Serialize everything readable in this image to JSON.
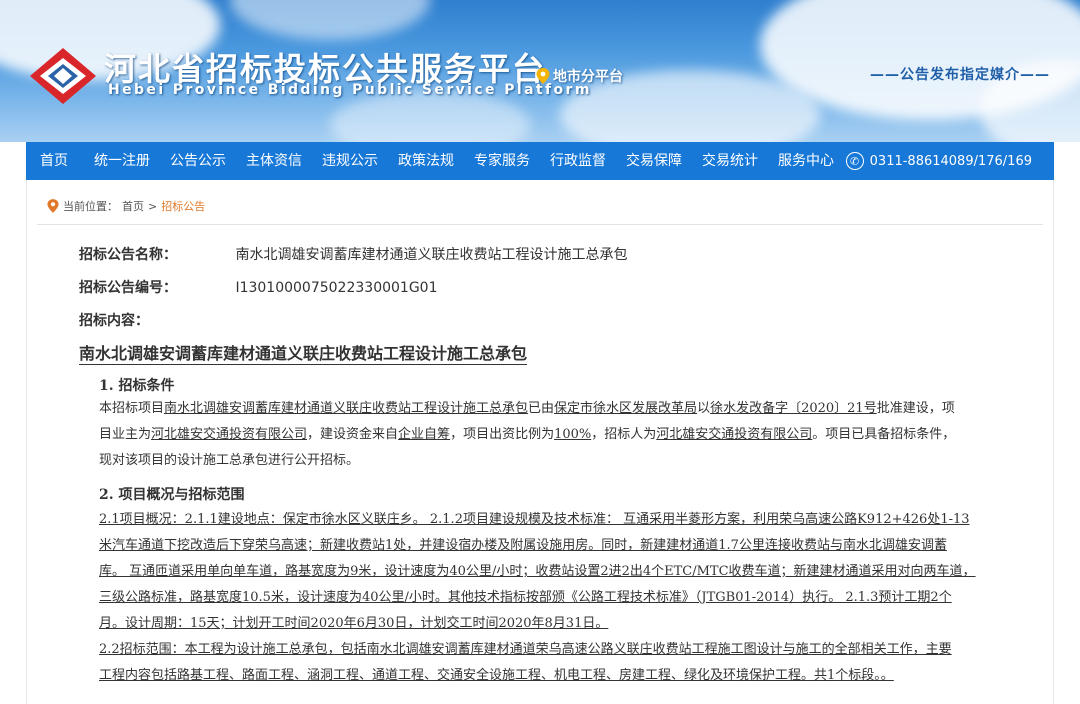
{
  "header": {
    "site_title": "河北省招标投标公共服务平台",
    "site_subtitle": "Hebei Province Bidding Public Service Platform",
    "city_link": "地市分平台",
    "media_note": "——公告发布指定媒介——"
  },
  "nav": {
    "items": [
      "首页",
      "统一注册",
      "公告公示",
      "主体资信",
      "违规公示",
      "政策法规",
      "专家服务",
      "行政监督",
      "交易保障",
      "交易统计",
      "服务中心"
    ],
    "phone": "0311-88614089/176/169"
  },
  "breadcrumb": {
    "prefix": "当前位置：",
    "home": "首页",
    "separator": ">",
    "current": "招标公告"
  },
  "fields": {
    "name_label": "招标公告名称：",
    "name_value": "南水北调雄安调蓄库建材通道义联庄收费站工程设计施工总承包",
    "code_label": "招标公告编号：",
    "code_value": "I1301000075022330001G01",
    "content_label": "招标内容："
  },
  "document": {
    "title": "南水北调雄安调蓄库建材通道义联庄收费站工程设计施工总承包",
    "section1_heading": "1. 招标条件",
    "section1": {
      "l1_a": "本招标项目",
      "l1_b": "南水北调雄安调蓄库建材通道义联庄收费站工程设计施工总承包",
      "l1_c": "已由",
      "l1_d": "保定市徐水区发展改革局",
      "l1_e": "以",
      "l1_f": "徐水发改备字〔2020〕21号",
      "l1_g": "批准建设，项",
      "l2_a": "目业主为",
      "l2_b": "河北雄安交通投资有限公司",
      "l2_c": "，建设资金来自",
      "l2_d": "企业自筹",
      "l2_e": "，项目出资比例为",
      "l2_f": "100%",
      "l2_g": "，招标人为",
      "l2_h": "河北雄安交通投资有限公司",
      "l2_i": "。项目已具备招标条件，",
      "l3": "现对该项目的设计施工总承包进行公开招标。"
    },
    "section2_heading": "2. 项目概况与招标范围",
    "section2_lines": [
      "2.1项目概况：2.1.1建设地点：保定市徐水区义联庄乡。 2.1.2项目建设规模及技术标准： 互通采用半菱形方案，利用荣乌高速公路K912+426处1-13",
      "米汽车通道下挖改造后下穿荣乌高速；新建收费站1处，并建设宿办楼及附属设施用房。同时，新建建材通道1.7公里连接收费站与南水北调雄安调蓄",
      "库。 互通匝道采用单向单车道，路基宽度为9米，设计速度为40公里/小时；收费站设置2进2出4个ETC/MTC收费车道；新建建材通道采用对向两车道，",
      "三级公路标准，路基宽度10.5米，设计速度为40公里/小时。其他技术指标按部颁《公路工程技术标准》（JTGB01-2014）执行。 2.1.3预计工期2个",
      "月。设计周期：15天；计划开工时间2020年6月30日，计划交工时间2020年8月31日。",
      "2.2招标范围：本工程为设计施工总承包，包括南水北调雄安调蓄库建材通道荣乌高速公路义联庄收费站工程施工图设计与施工的全部相关工作，主要",
      "工程内容包括路基工程、路面工程、涵洞工程、通道工程、交通安全设施工程、机电工程、房建工程、绿化及环境保护工程。共1个标段。。"
    ]
  },
  "colors": {
    "nav_bg": "#1778d8",
    "accent_orange": "#e07a2a",
    "logo_red": "#d9262b",
    "logo_blue": "#2a63a8"
  }
}
